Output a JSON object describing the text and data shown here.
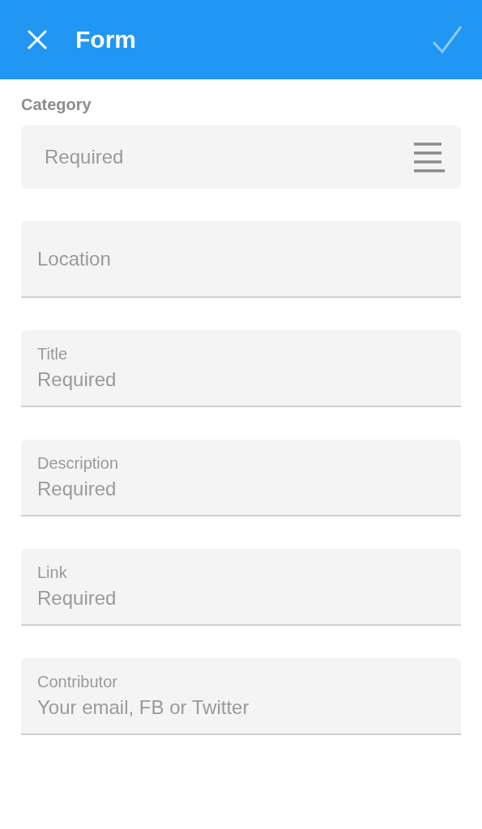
{
  "app_bar": {
    "title": "Form",
    "submit": {
      "disabled": true
    }
  },
  "category": {
    "label": "Category",
    "placeholder": "Required"
  },
  "fields": [
    {
      "placeholder": "Location"
    },
    {
      "label": "Title",
      "placeholder": "Required"
    },
    {
      "label": "Description",
      "placeholder": "Required"
    },
    {
      "label": "Link",
      "placeholder": "Required"
    },
    {
      "label": "Contributor",
      "placeholder": "Your email, FB or Twitter"
    }
  ]
}
